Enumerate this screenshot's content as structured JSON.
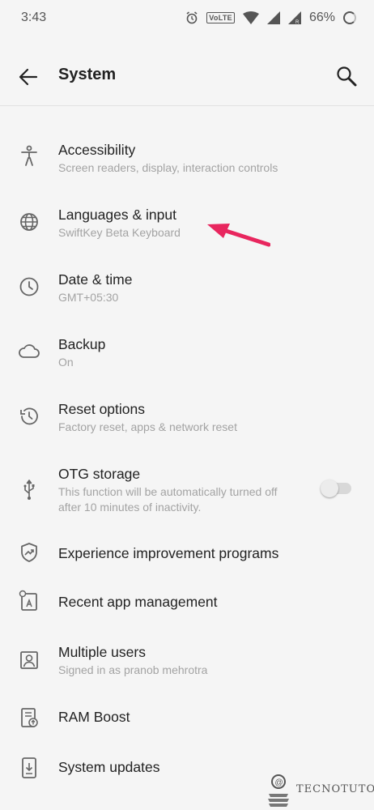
{
  "status_bar": {
    "time": "3:43",
    "network_badge": "VoLTE",
    "battery_percent": "66%",
    "icons": [
      "alarm-icon",
      "volte-icon",
      "wifi-icon",
      "signal-icon",
      "signal-r-icon",
      "battery-icon"
    ]
  },
  "app_bar": {
    "title": "System",
    "back_icon": "arrow-left-icon",
    "search_icon": "search-icon"
  },
  "items": [
    {
      "icon": "accessibility-icon",
      "title": "Accessibility",
      "subtitle": "Screen readers, display, interaction controls"
    },
    {
      "icon": "globe-icon",
      "title": "Languages & input",
      "subtitle": "SwiftKey Beta Keyboard"
    },
    {
      "icon": "clock-icon",
      "title": "Date & time",
      "subtitle": "GMT+05:30"
    },
    {
      "icon": "cloud-icon",
      "title": "Backup",
      "subtitle": "On"
    },
    {
      "icon": "history-icon",
      "title": "Reset options",
      "subtitle": "Factory reset, apps & network reset"
    },
    {
      "icon": "usb-icon",
      "title": "OTG storage",
      "subtitle": "This function will be automatically turned off after 10 minutes of inactivity.",
      "toggle_on": false
    },
    {
      "icon": "shield-trend-icon",
      "title": "Experience improvement programs"
    },
    {
      "icon": "recent-apps-icon",
      "title": "Recent app management"
    },
    {
      "icon": "person-icon",
      "title": "Multiple users",
      "subtitle": "Signed in as pranob mehrotra"
    },
    {
      "icon": "ram-boost-icon",
      "title": "RAM Boost"
    },
    {
      "icon": "system-update-icon",
      "title": "System updates"
    }
  ],
  "annotation": {
    "color": "#e8265e"
  },
  "watermark": {
    "text": "TECNOTUTO"
  }
}
